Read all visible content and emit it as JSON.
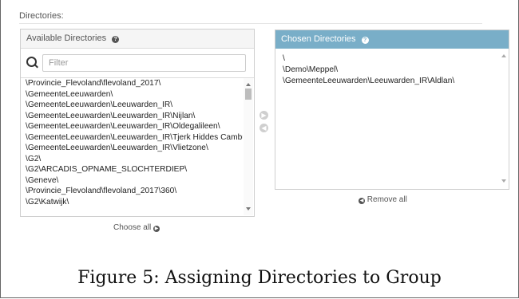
{
  "directories_label": "Directories:",
  "available": {
    "title": "Available Directories",
    "filter_placeholder": "Filter",
    "items": [
      "\\Provincie_Flevoland\\flevoland_2017\\",
      "\\GemeenteLeeuwarden\\",
      "\\GemeenteLeeuwarden\\Leeuwarden_IR\\",
      "\\GemeenteLeeuwarden\\Leeuwarden_IR\\Nijlan\\",
      "\\GemeenteLeeuwarden\\Leeuwarden_IR\\Oldegalileen\\",
      "\\GemeenteLeeuwarden\\Leeuwarden_IR\\Tjerk Hiddes Cambu",
      "\\GemeenteLeeuwarden\\Leeuwarden_IR\\Vlietzone\\",
      "\\G2\\",
      "\\G2\\ARCADIS_OPNAME_SLOCHTERDIEP\\",
      "\\Geneve\\",
      "\\Provincie_Flevoland\\flevoland_2017\\360\\",
      "\\G2\\Katwijk\\"
    ],
    "choose_all_label": "Choose all"
  },
  "chosen": {
    "title": "Chosen Directories",
    "items": [
      "\\",
      "\\Demo\\Meppel\\",
      "\\GemeenteLeeuwarden\\Leeuwarden_IR\\Aldlan\\"
    ],
    "remove_all_label": "Remove all"
  },
  "caption": "Figure 5: Assigning Directories to Group",
  "colors": {
    "chosen_header": "#79aec8",
    "available_header": "#f5f5f5"
  }
}
